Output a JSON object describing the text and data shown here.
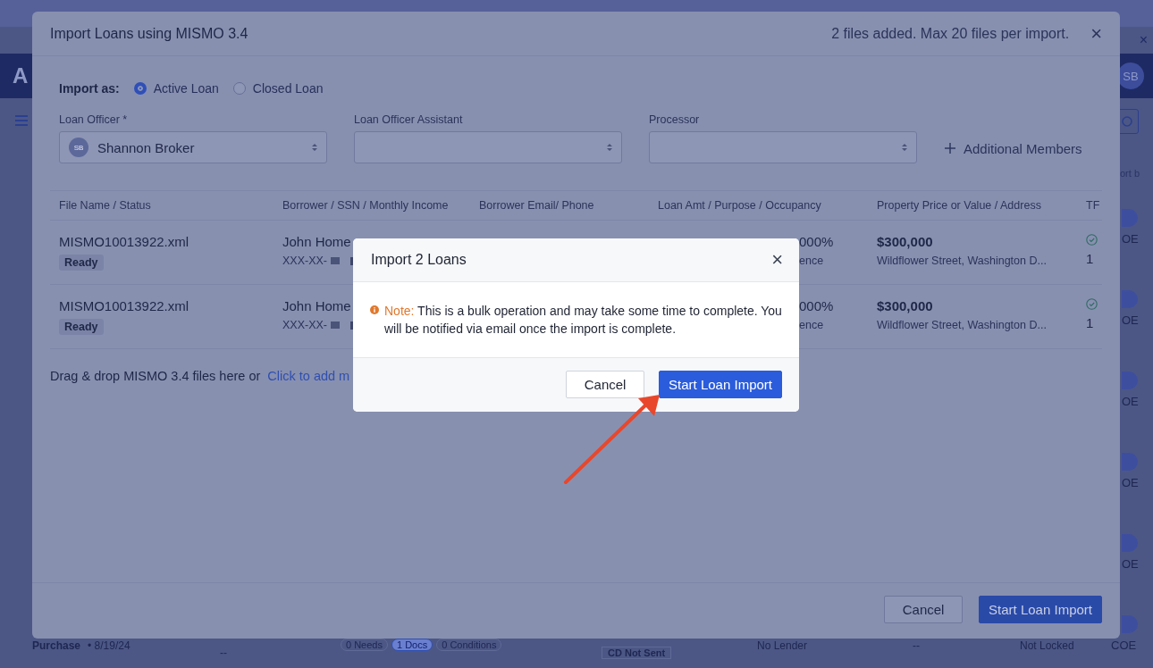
{
  "background": {
    "logo": "A",
    "avatar": "SB",
    "close": "×",
    "side_text": "ort b",
    "right_column": [
      {
        "label": "OE"
      },
      {
        "label": "OE"
      },
      {
        "label": "OE"
      },
      {
        "label": "OE"
      },
      {
        "label": "OE"
      },
      {
        "label": "COE"
      }
    ],
    "bottom_row": {
      "purpose": "Purchase",
      "date": "• 8/19/24",
      "dash_1": "--",
      "tags": [
        "0 Needs",
        "1 Docs",
        "0 Conditions"
      ],
      "cd_status": "CD Not Sent",
      "lender": "No Lender",
      "dash_2": "--",
      "lock": "Not Locked"
    }
  },
  "import_modal": {
    "title": "Import Loans using MISMO 3.4",
    "file_count": "2 files added. Max 20 files per import.",
    "close": "×",
    "import_as": {
      "label": "Import as:",
      "options": [
        {
          "label": "Active Loan",
          "selected": true
        },
        {
          "label": "Closed Loan",
          "selected": false
        }
      ]
    },
    "fields": [
      {
        "label": "Loan Officer *",
        "avatar": "SB",
        "value": "Shannon Broker"
      },
      {
        "label": "Loan Officer Assistant"
      },
      {
        "label": "Processor"
      }
    ],
    "additional_members": "Additional Members",
    "table": {
      "columns": [
        "File Name / Status",
        "Borrower / SSN / Monthly Income",
        "Borrower Email/ Phone",
        "Loan Amt / Purpose / Occupancy",
        "Property Price or Value / Address",
        "TF"
      ],
      "rows": [
        {
          "file": "MISMO10013922.xml",
          "status": "Ready",
          "borrower": "John Home",
          "ssn": "XXX-XX-",
          "loan_line_1": "000%",
          "loan_line_2": "ence",
          "price": "$300,000",
          "address": "Wildflower Street, Washington D...",
          "tf_checked": true,
          "tf_value": "1"
        },
        {
          "file": "MISMO10013922.xml",
          "status": "Ready",
          "borrower": "John Home",
          "ssn": "XXX-XX-",
          "loan_line_1": "000%",
          "loan_line_2": "ence",
          "price": "$300,000",
          "address": "Wildflower Street, Washington D...",
          "tf_checked": true,
          "tf_value": "1"
        }
      ]
    },
    "drop_text": "Drag & drop MISMO 3.4 files here or",
    "drop_link": "Click to add m",
    "buttons": [
      {
        "label": "Cancel",
        "kind": "secondary"
      },
      {
        "label": "Start Loan Import",
        "kind": "primary"
      }
    ]
  },
  "confirm_dialog": {
    "title": "Import 2 Loans",
    "close": "×",
    "note_label": "Note:",
    "message": "This is a bulk operation and may take some time to complete. You will be notified via email once the import is complete.",
    "buttons": [
      {
        "label": "Cancel",
        "kind": "secondary"
      },
      {
        "label": "Start Loan Import",
        "kind": "primary"
      }
    ]
  }
}
